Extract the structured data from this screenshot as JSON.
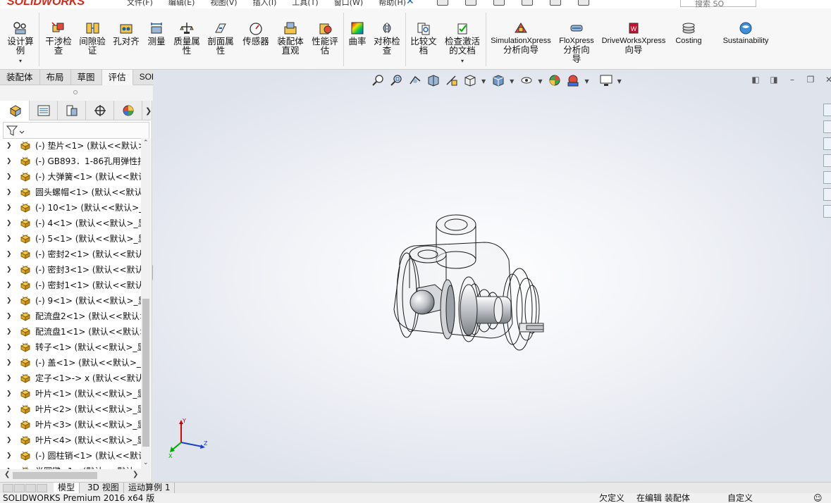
{
  "app": {
    "logo": "SOLIDWORKS",
    "menu": [
      "文件(F)",
      "编辑(E)",
      "视图(V)",
      "插入(I)",
      "工具(T)",
      "窗口(W)",
      "帮助(H)"
    ],
    "search_placeholder": "搜索 SO"
  },
  "ribbon": {
    "buttons": [
      {
        "label1": "设计算",
        "label2": "例",
        "dropdown": "▾",
        "icon": "design-study-icon"
      },
      {
        "label1": "干涉检",
        "label2": "查",
        "icon": "interference-detection-icon"
      },
      {
        "label1": "间隙验",
        "label2": "证",
        "icon": "clearance-verification-icon"
      },
      {
        "label1": "孔对齐",
        "label2": "",
        "icon": "hole-alignment-icon"
      },
      {
        "label1": "测量",
        "label2": "",
        "icon": "measure-icon"
      },
      {
        "label1": "质量属",
        "label2": "性",
        "icon": "mass-properties-icon"
      },
      {
        "label1": "剖面属",
        "label2": "性",
        "icon": "section-properties-icon"
      },
      {
        "label1": "传感器",
        "label2": "",
        "icon": "sensor-icon"
      },
      {
        "label1": "装配体",
        "label2": "直观",
        "icon": "assembly-visualization-icon"
      },
      {
        "label1": "性能评",
        "label2": "估",
        "icon": "performance-evaluation-icon"
      },
      {
        "label1": "曲率",
        "label2": "",
        "icon": "curvature-icon"
      },
      {
        "label1": "对称检",
        "label2": "查",
        "icon": "symmetry-check-icon"
      },
      {
        "label1": "比较文",
        "label2": "档",
        "icon": "compare-documents-icon"
      },
      {
        "label1": "检查激活",
        "label2": "的文档",
        "dropdown": "▾",
        "icon": "check-active-document-icon"
      },
      {
        "label1": "SimulationXpress",
        "label2": "分析向导",
        "icon": "simulationxpress-icon"
      },
      {
        "label1": "FloXpress",
        "label2": "分析向",
        "label3": "导",
        "icon": "floxpress-icon"
      },
      {
        "label1": "DriveWorksXpress",
        "label2": "向导",
        "icon": "driveworksxpress-icon"
      },
      {
        "label1": "Costing",
        "label2": "",
        "icon": "costing-icon"
      },
      {
        "label1": "Sustainability",
        "label2": "",
        "icon": "sustainability-icon"
      }
    ]
  },
  "command_tabs": [
    "装配体",
    "布局",
    "草图",
    "评估",
    "SOLIDWORKS 插件"
  ],
  "active_command_tab": "评估",
  "tree": {
    "items": [
      "(-) 垫片<1> (默认<<默认>",
      "(-) GB893．1-86孔用弹性挡",
      "(-) 大弹簧<1> (默认<<默认",
      "圆头螺帽<1> (默认<<默认",
      "(-) 10<1> (默认<<默认>_显",
      "(-) 4<1> (默认<<默认>_显",
      "(-) 5<1> (默认<<默认>_显",
      "(-) 密封2<1> (默认<<默认",
      "(-) 密封3<1> (默认<<默认",
      "(-) 密封1<1> (默认<<默认",
      "(-) 9<1> (默认<<默认>_显",
      "配流盘2<1> (默认<<默认>",
      "配流盘1<1> (默认<<默认>",
      "转子<1> (默认<<默认>_显",
      "(-) 盖<1> (默认<<默认>_显",
      "定子<1>-> x (默认<<默认",
      "叶片<1> (默认<<默认>_显",
      "叶片<2> (默认<<默认>_显",
      "叶片<3> (默认<<默认>_显",
      "叶片<4> (默认<<默认>_显",
      "(-) 圆柱销<1> (默认<<默认",
      "半圆键<1> (默认<<默认"
    ]
  },
  "bottom_tabs": [
    "模型",
    "3D 视图",
    "运动算例 1"
  ],
  "active_bottom_tab": "模型",
  "status": {
    "product": "SOLIDWORKS Premium 2016 x64 版",
    "state": "欠定义",
    "mode": "在编辑 装配体",
    "custom": "自定义"
  },
  "colors": {
    "logo": "#d52a1b",
    "ribbon_bg": "#f7f7f7",
    "component_icon": "#e8b93a"
  }
}
